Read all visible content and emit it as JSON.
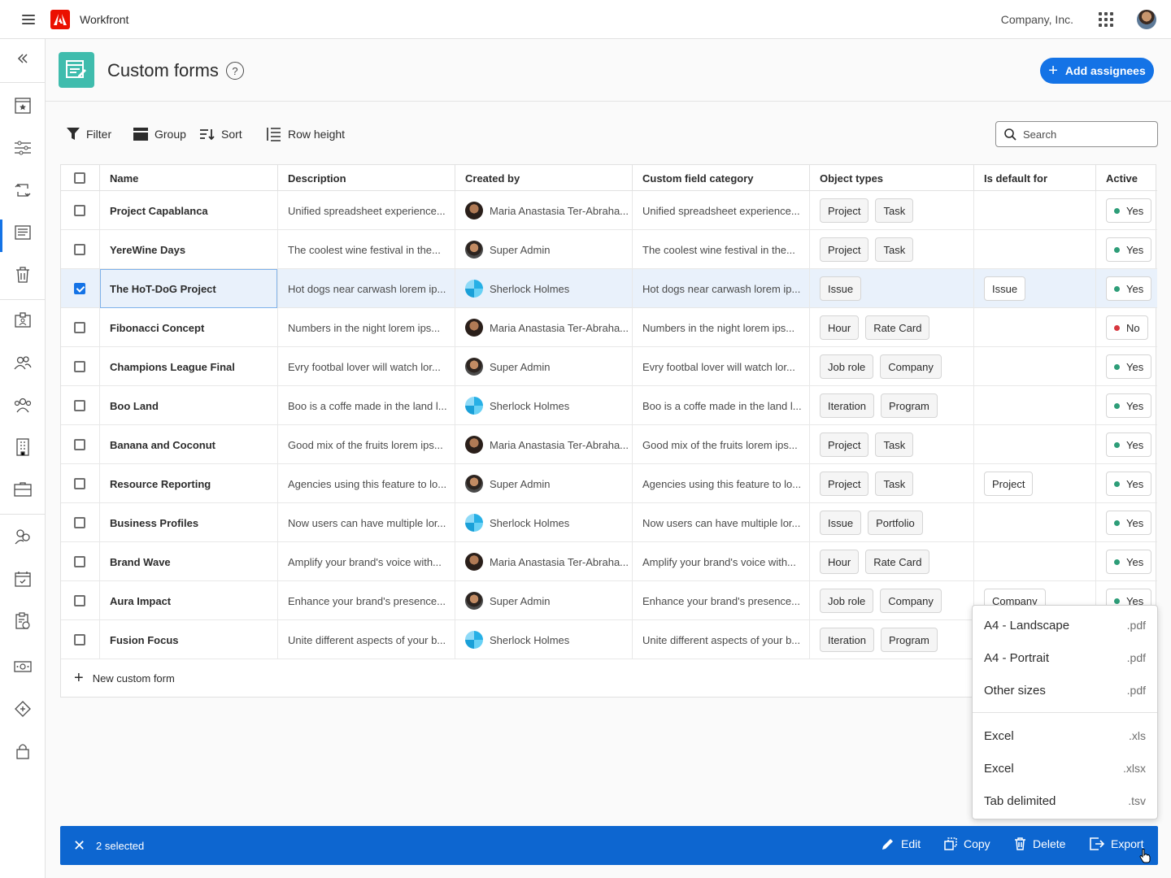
{
  "topbar": {
    "app_name": "Workfront",
    "company": "Company, Inc."
  },
  "header": {
    "title": "Custom forms",
    "help": "?",
    "add_button": "Add assignees"
  },
  "toolbar": {
    "filter": "Filter",
    "group": "Group",
    "sort": "Sort",
    "row_height": "Row height",
    "search_placeholder": "Search"
  },
  "columns": [
    "Name",
    "Description",
    "Created by",
    "Custom field category",
    "Object types",
    "Is default for",
    "Active"
  ],
  "rows": [
    {
      "name": "Project Capablanca",
      "description": "Unified spreadsheet experience...",
      "creator": "Maria Anastasia Ter-Abraha...",
      "avatar": "maria",
      "category": "Unified spreadsheet experience...",
      "types": [
        "Project",
        "Task"
      ],
      "default": [],
      "active": "Yes",
      "checked": false
    },
    {
      "name": "YereWine Days",
      "description": "The coolest wine festival in the...",
      "creator": "Super Admin",
      "avatar": "admin",
      "category": "The coolest wine festival in the...",
      "types": [
        "Project",
        "Task"
      ],
      "default": [],
      "active": "Yes",
      "checked": false
    },
    {
      "name": "The HoT-DoG Project",
      "description": "Hot dogs near carwash lorem ip...",
      "creator": "Sherlock Holmes",
      "avatar": "sherlock",
      "category": "Hot dogs near carwash lorem ip...",
      "types": [
        "Issue"
      ],
      "default": [
        "Issue"
      ],
      "active": "Yes",
      "checked": true
    },
    {
      "name": "Fibonacci Concept",
      "description": "Numbers in the night lorem ips...",
      "creator": "Maria Anastasia Ter-Abraha...",
      "avatar": "maria",
      "category": "Numbers in the night lorem ips...",
      "types": [
        "Hour",
        "Rate Card"
      ],
      "default": [],
      "active": "No",
      "checked": false
    },
    {
      "name": "Champions League Final",
      "description": "Evry footbal lover will watch lor...",
      "creator": "Super Admin",
      "avatar": "admin",
      "category": "Evry footbal lover will watch lor...",
      "types": [
        "Job role",
        "Company"
      ],
      "default": [],
      "active": "Yes",
      "checked": false
    },
    {
      "name": "Boo Land",
      "description": "Boo is a coffe made in the land l...",
      "creator": "Sherlock Holmes",
      "avatar": "sherlock",
      "category": "Boo is a coffe made in the land l...",
      "types": [
        "Iteration",
        "Program"
      ],
      "default": [],
      "active": "Yes",
      "checked": false
    },
    {
      "name": "Banana and Coconut",
      "description": "Good mix of the fruits lorem ips...",
      "creator": "Maria Anastasia Ter-Abraha...",
      "avatar": "maria",
      "category": "Good mix of the fruits lorem ips...",
      "types": [
        "Project",
        "Task"
      ],
      "default": [],
      "active": "Yes",
      "checked": false
    },
    {
      "name": "Resource Reporting",
      "description": "Agencies using this feature to lo...",
      "creator": "Super Admin",
      "avatar": "admin",
      "category": "Agencies using this feature to lo...",
      "types": [
        "Project",
        "Task"
      ],
      "default": [
        "Project"
      ],
      "active": "Yes",
      "checked": false
    },
    {
      "name": "Business Profiles",
      "description": "Now users can have multiple lor...",
      "creator": "Sherlock Holmes",
      "avatar": "sherlock",
      "category": "Now users can have multiple lor...",
      "types": [
        "Issue",
        "Portfolio"
      ],
      "default": [],
      "active": "Yes",
      "checked": false
    },
    {
      "name": "Brand Wave",
      "description": "Amplify your brand's voice with...",
      "creator": "Maria Anastasia Ter-Abraha...",
      "avatar": "maria",
      "category": "Amplify your brand's voice with...",
      "types": [
        "Hour",
        "Rate Card"
      ],
      "default": [],
      "active": "Yes",
      "checked": false
    },
    {
      "name": "Aura Impact",
      "description": "Enhance your brand's presence...",
      "creator": "Super Admin",
      "avatar": "admin",
      "category": "Enhance your brand's presence...",
      "types": [
        "Job role",
        "Company"
      ],
      "default": [
        "Company"
      ],
      "active": "Yes",
      "checked": false
    },
    {
      "name": "Fusion Focus",
      "description": "Unite different aspects of your b...",
      "creator": "Sherlock Holmes",
      "avatar": "sherlock",
      "category": "Unite different aspects of your b...",
      "types": [
        "Iteration",
        "Program"
      ],
      "default": [],
      "active": "",
      "checked": false
    }
  ],
  "new_form": "New custom form",
  "export_menu": [
    {
      "label": "A4 - Landscape",
      "ext": ".pdf"
    },
    {
      "label": "A4 - Portrait",
      "ext": ".pdf"
    },
    {
      "label": "Other sizes",
      "ext": ".pdf"
    },
    {
      "label": "Excel",
      "ext": ".xls"
    },
    {
      "label": "Excel",
      "ext": ".xlsx"
    },
    {
      "label": "Tab delimited",
      "ext": ".tsv"
    }
  ],
  "actionbar": {
    "count": "2 selected",
    "edit": "Edit",
    "copy": "Copy",
    "delete": "Delete",
    "export": "Export"
  },
  "colors": {
    "accent": "#1473e6",
    "actionbar": "#0d66d0",
    "active_yes": "#2d9d78",
    "active_no": "#d7373f",
    "form_icon": "#3fbcad"
  }
}
